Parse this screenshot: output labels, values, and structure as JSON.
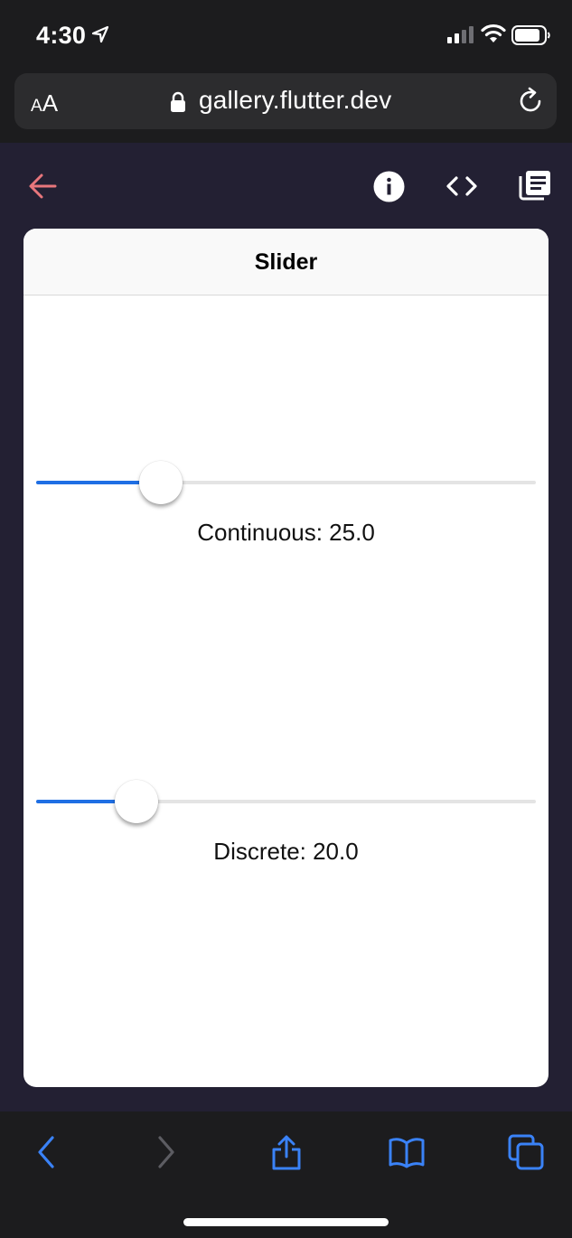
{
  "status_bar": {
    "time": "4:30",
    "icons": [
      "location-arrow-icon",
      "cellular-signal-icon",
      "wifi-icon",
      "battery-icon"
    ]
  },
  "browser": {
    "text_size_small": "A",
    "text_size_large": "A",
    "url": "gallery.flutter.dev",
    "icons": [
      "lock-icon",
      "reload-icon"
    ]
  },
  "app_bar": {
    "icons": [
      "back-arrow-icon",
      "info-icon",
      "code-icon",
      "library-icon"
    ],
    "back_color": "#e8767c"
  },
  "card": {
    "title": "Slider",
    "continuous": {
      "label": "Continuous: 25.0",
      "value": 25.0,
      "min": 0,
      "max": 100
    },
    "discrete": {
      "label": "Discrete: 20.0",
      "value": 20.0,
      "min": 0,
      "max": 100
    }
  },
  "colors": {
    "slider_active": "#1f6fe4",
    "slider_inactive": "#e4e4e4",
    "app_background": "#232033",
    "toolbar_icon": "#3a82f7",
    "toolbar_icon_disabled": "#5c5c62"
  },
  "toolbar": {
    "icons": [
      "back-icon",
      "forward-icon",
      "share-icon",
      "bookmarks-icon",
      "tabs-icon"
    ]
  }
}
